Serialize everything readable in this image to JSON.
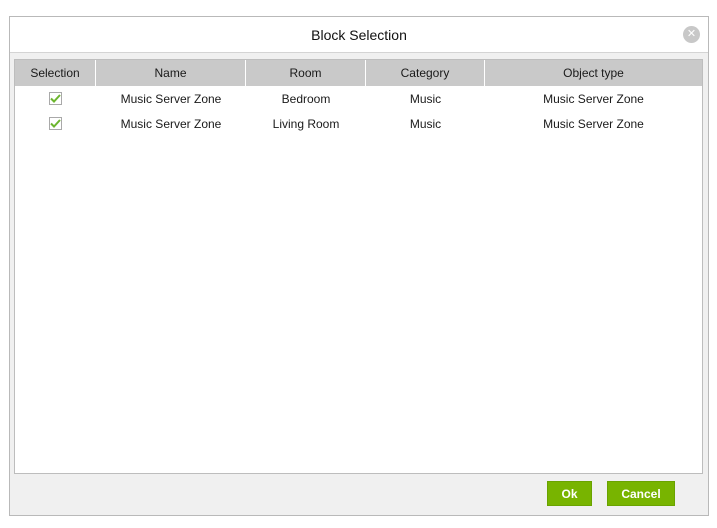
{
  "dialog": {
    "title": "Block Selection",
    "ok_label": "Ok",
    "cancel_label": "Cancel"
  },
  "table": {
    "columns": [
      "Selection",
      "Name",
      "Room",
      "Category",
      "Object type"
    ],
    "rows": [
      {
        "selected": true,
        "name": "Music Server Zone",
        "room": "Bedroom",
        "category": "Music",
        "object_type": "Music Server Zone"
      },
      {
        "selected": true,
        "name": "Music Server Zone",
        "room": "Living Room",
        "category": "Music",
        "object_type": "Music Server Zone"
      }
    ]
  },
  "colors": {
    "accent": "#78b400",
    "header_bg": "#c9c9c9",
    "check": "#6cb62e"
  }
}
